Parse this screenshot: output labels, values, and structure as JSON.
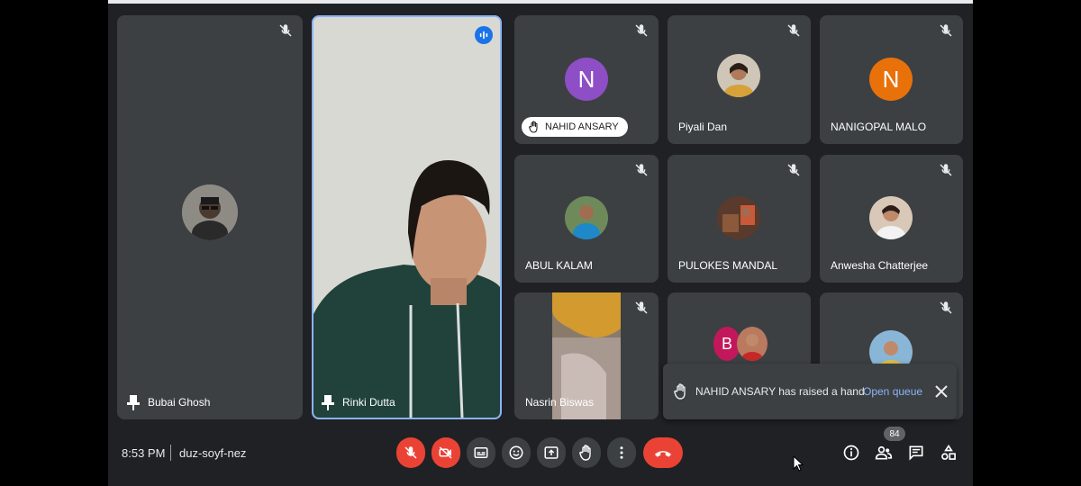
{
  "participants": {
    "bubai": {
      "name": "Bubai Ghosh"
    },
    "rinki": {
      "name": "Rinki Dutta"
    },
    "nahid": {
      "name": "NAHID ANSARY",
      "initial": "N",
      "color": "#8e4ec6"
    },
    "piyali": {
      "name": "Piyali Dan"
    },
    "nanigopal": {
      "name": "NANIGOPAL MALO",
      "initial": "N",
      "color": "#e8710a"
    },
    "abul": {
      "name": "ABUL KALAM"
    },
    "pulokes": {
      "name": "PULOKES MANDAL"
    },
    "anwesha": {
      "name": "Anwesha Chatterjee"
    },
    "nasrin": {
      "name": "Nasrin Biswas"
    },
    "b_group": {
      "initial": "B",
      "color": "#c2185b"
    }
  },
  "toast": {
    "message": "NAHID ANSARY has raised a hand",
    "action": "Open queue"
  },
  "meeting": {
    "time": "8:53 PM",
    "separator": "|",
    "code": "duz-soyf-nez",
    "participant_count": "84"
  },
  "colors": {
    "accent_blue": "#8ab4f8",
    "danger_red": "#ea4335",
    "tile_bg": "#3c4043",
    "active_border": "#8ab4f8"
  }
}
